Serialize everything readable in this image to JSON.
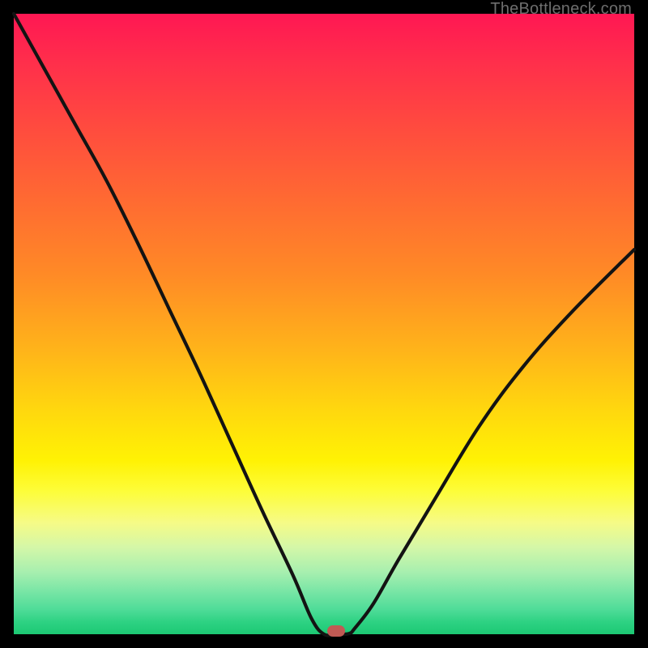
{
  "watermark": "TheBottleneck.com",
  "colors": {
    "frame": "#000000",
    "curve_stroke": "#131313",
    "marker_fill": "#c15a54",
    "gradient_top": "#ff1753",
    "gradient_bottom": "#1cc873"
  },
  "chart_data": {
    "type": "line",
    "title": "",
    "xlabel": "",
    "ylabel": "",
    "xlim": [
      0,
      100
    ],
    "ylim": [
      0,
      100
    ],
    "grid": false,
    "series": [
      {
        "name": "bottleneck-curve",
        "x": [
          0,
          5,
          10,
          15,
          20,
          25,
          30,
          35,
          40,
          45,
          48,
          50,
          52,
          54,
          55,
          58,
          62,
          68,
          75,
          82,
          90,
          100
        ],
        "values": [
          100,
          91,
          82,
          73,
          63,
          52.5,
          42,
          31,
          20,
          9.5,
          2.5,
          0,
          0,
          0.1,
          1,
          5,
          12,
          22,
          33.5,
          43,
          52,
          62
        ]
      }
    ],
    "marker": {
      "x": 52,
      "y": 0
    }
  }
}
